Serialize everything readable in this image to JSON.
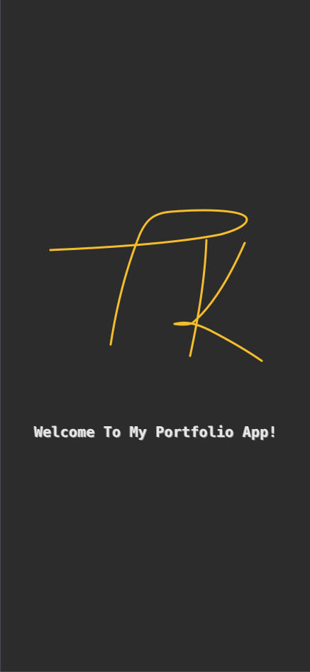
{
  "splash": {
    "logo": {
      "icon": "tk-signature-logo",
      "color": "#f5bd2b"
    },
    "welcome_text": "Welcome To My Portfolio App!",
    "background_color": "#2c2c2c",
    "text_color": "#e8e8e8"
  }
}
